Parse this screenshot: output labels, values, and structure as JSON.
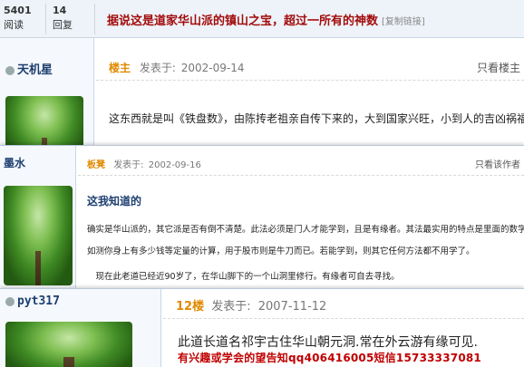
{
  "header": {
    "views_count": "5401",
    "views_label": "阅读",
    "replies_count": "14",
    "replies_label": "回复",
    "title": "据说这是道家华山派的镇山之宝，超过一所有的神数",
    "copy_link": "[复制链接]"
  },
  "posts": [
    {
      "username": "天机星",
      "floor": "楼主",
      "posted_label": "发表于:",
      "date": "2002-09-14",
      "right_action": "只看楼主",
      "lines": [
        "这东西就是叫《铁盘数》，由陈抟老祖亲自传下来的，大到国家兴旺，小到人的吉凶祸福，无不在其中，"
      ]
    },
    {
      "username": "墨水",
      "floor": "板凳",
      "posted_label": "发表于:",
      "date": "2002-09-16",
      "right_action": "只看该作者",
      "heading": "这我知道的",
      "lines": [
        "确实是华山派的，其它派是否有倒不清楚。此法必须是门人才能学到，且是有缘者。其法最实用的特点是里面的数学计算，比",
        "如测你身上有多少钱等定量的计算，用于股市则是牛刀而已。若能学到，则其它任何方法都不用学了。",
        "　现在此老道已经近90岁了，在华山脚下的一个山洞里修行。有缘者可自去寻找。"
      ]
    },
    {
      "username": "pyt317",
      "floor": "12楼",
      "posted_label": "发表于:",
      "date": "2007-11-12",
      "lines": [
        "此道长道名祁宇古住华山朝元洞.常在外云游有缘可见."
      ]
    }
  ],
  "banner": "有兴趣或学会的望告知qq406416005短信15733337081"
}
